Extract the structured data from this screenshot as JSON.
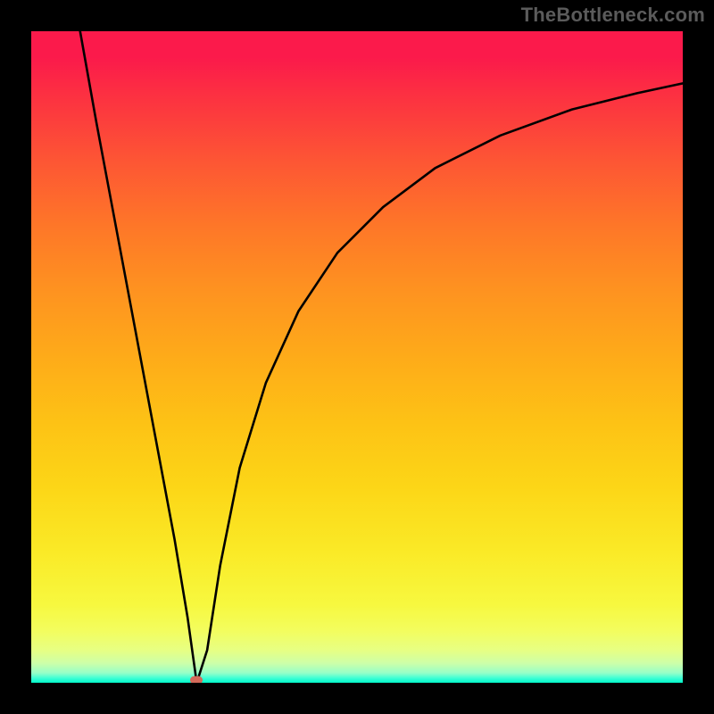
{
  "watermark": "TheBottleneck.com",
  "colors": {
    "min_marker": "#d36a5a",
    "curve_stroke": "#000000"
  },
  "chart_data": {
    "type": "line",
    "title": "",
    "xlabel": "",
    "ylabel": "",
    "xlim": [
      0,
      100
    ],
    "ylim": [
      0,
      100
    ],
    "grid": false,
    "legend": false,
    "annotations": [],
    "curve_points": [
      {
        "x": 7.5,
        "y": 100.0
      },
      {
        "x": 10.0,
        "y": 86.0
      },
      {
        "x": 13.0,
        "y": 70.0
      },
      {
        "x": 16.0,
        "y": 54.0
      },
      {
        "x": 19.0,
        "y": 38.0
      },
      {
        "x": 22.0,
        "y": 22.0
      },
      {
        "x": 24.0,
        "y": 10.0
      },
      {
        "x": 25.4,
        "y": 0.0
      },
      {
        "x": 27.0,
        "y": 5.0
      },
      {
        "x": 29.0,
        "y": 18.0
      },
      {
        "x": 32.0,
        "y": 33.0
      },
      {
        "x": 36.0,
        "y": 46.0
      },
      {
        "x": 41.0,
        "y": 57.0
      },
      {
        "x": 47.0,
        "y": 66.0
      },
      {
        "x": 54.0,
        "y": 73.0
      },
      {
        "x": 62.0,
        "y": 79.0
      },
      {
        "x": 72.0,
        "y": 84.0
      },
      {
        "x": 83.0,
        "y": 88.0
      },
      {
        "x": 93.0,
        "y": 90.5
      },
      {
        "x": 100.0,
        "y": 92.0
      }
    ],
    "min_point": {
      "x": 25.4,
      "y": 0.0
    }
  }
}
